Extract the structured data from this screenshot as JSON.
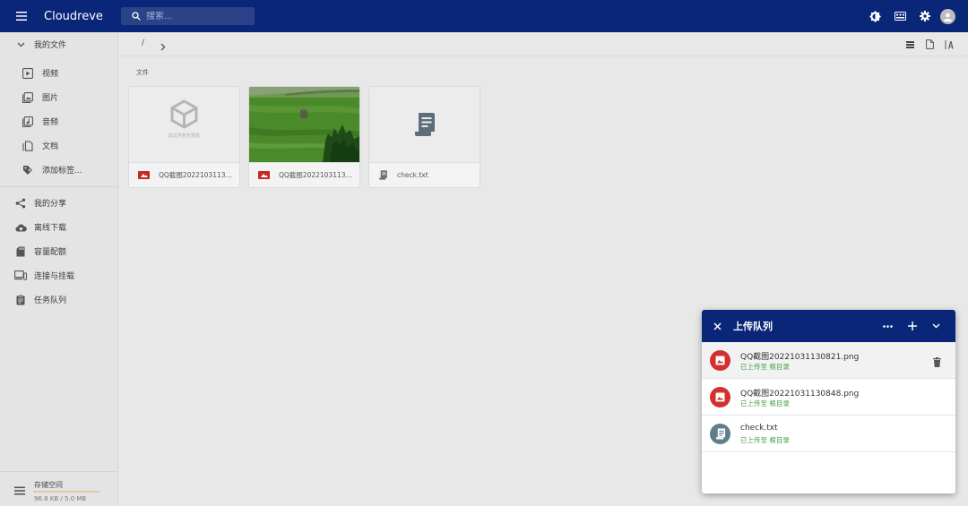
{
  "header": {
    "app_title": "Cloudreve",
    "search_placeholder": "搜索..."
  },
  "sidebar": {
    "my_files": "我的文件",
    "file_types": [
      {
        "label": "视频",
        "icon": "video-icon"
      },
      {
        "label": "图片",
        "icon": "image-icon"
      },
      {
        "label": "音频",
        "icon": "audio-icon"
      },
      {
        "label": "文档",
        "icon": "document-icon"
      },
      {
        "label": "添加标签...",
        "icon": "tag-add-icon"
      }
    ],
    "nav": [
      {
        "label": "我的分享",
        "icon": "share-icon"
      },
      {
        "label": "离线下载",
        "icon": "cloud-download-icon"
      },
      {
        "label": "容量配额",
        "icon": "sd-card-icon"
      },
      {
        "label": "连接与挂载",
        "icon": "devices-icon"
      },
      {
        "label": "任务队列",
        "icon": "task-list-icon"
      }
    ],
    "storage": {
      "label": "存储空间",
      "value": "96.8 KB / 5.0 MB",
      "used_fraction": 0.019
    }
  },
  "main": {
    "breadcrumb_root": "/",
    "section_title": "文件",
    "files": [
      {
        "name": "QQ截图20221031130821.png",
        "type": "image",
        "thumb": "placeholder",
        "thumb_caption": "此文件暂无预览"
      },
      {
        "name": "QQ截图20221031130848.png",
        "type": "image",
        "thumb": "photo"
      },
      {
        "name": "check.txt",
        "type": "text",
        "thumb": "text-doc"
      }
    ]
  },
  "upload_panel": {
    "title": "上传队列",
    "tasks": [
      {
        "name": "QQ截图20221031130821.png",
        "status": "已上传至 根目录",
        "type": "image"
      },
      {
        "name": "QQ截图20221031130848.png",
        "status": "已上传至 根目录",
        "type": "image"
      },
      {
        "name": "check.txt",
        "status": "已上传至 根目录",
        "type": "text"
      }
    ]
  },
  "colors": {
    "primary": "#0a2679",
    "image_file": "#d32f2f",
    "text_file": "#607d8b",
    "success": "#43a047"
  }
}
